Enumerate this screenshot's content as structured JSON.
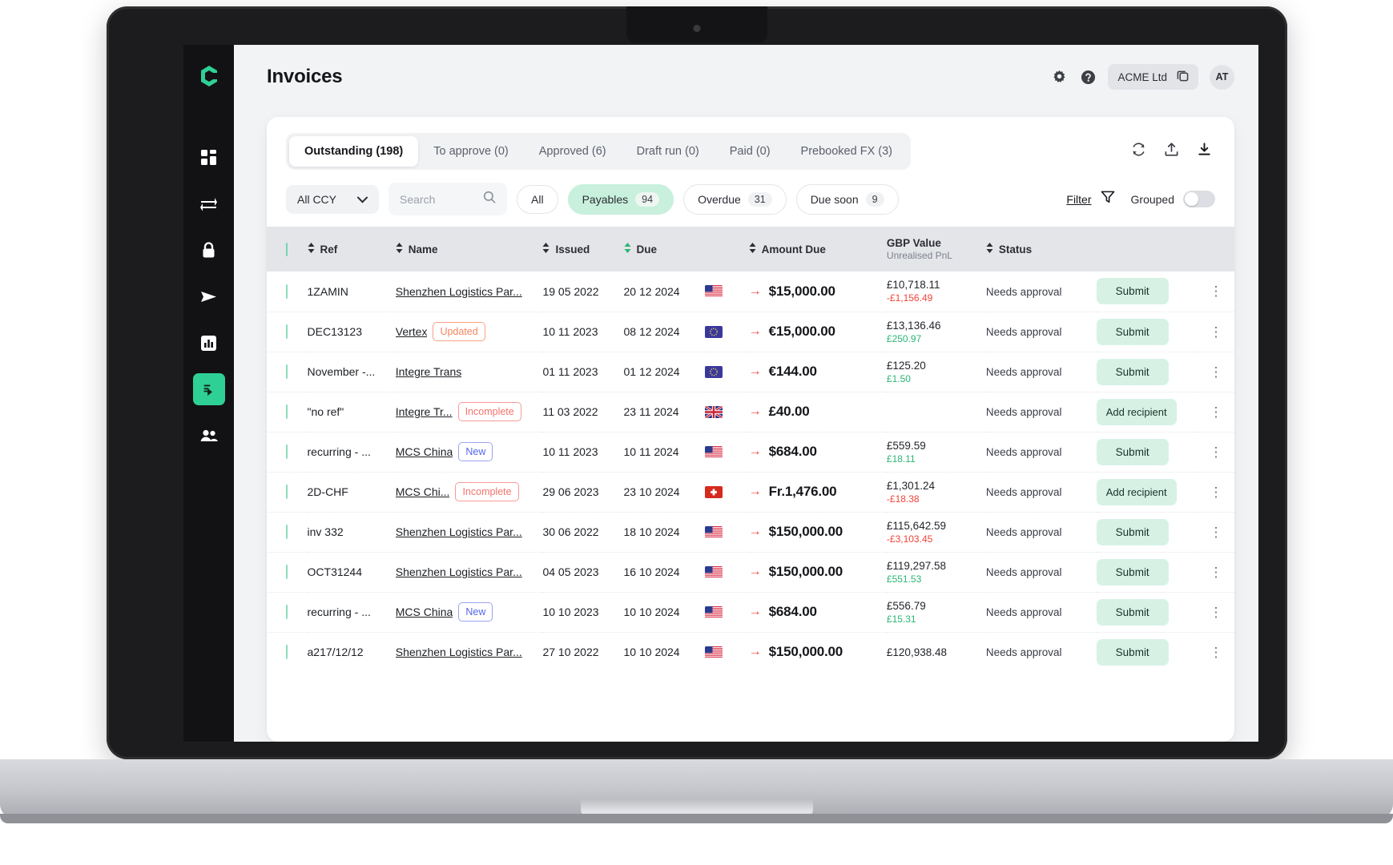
{
  "header": {
    "title": "Invoices",
    "org_name": "ACME Ltd",
    "avatar_initials": "AT"
  },
  "tabs": [
    {
      "label": "Outstanding (198)",
      "active": true
    },
    {
      "label": "To approve (0)",
      "active": false
    },
    {
      "label": "Approved (6)",
      "active": false
    },
    {
      "label": "Draft run (0)",
      "active": false
    },
    {
      "label": "Paid (0)",
      "active": false
    },
    {
      "label": "Prebooked FX (3)",
      "active": false
    }
  ],
  "filters": {
    "currency_select": "All CCY",
    "search_placeholder": "Search",
    "search_value": "",
    "chips": [
      {
        "label": "All",
        "count": "",
        "active": false
      },
      {
        "label": "Payables",
        "count": "94",
        "active": true
      },
      {
        "label": "Overdue",
        "count": "31",
        "active": false
      },
      {
        "label": "Due soon",
        "count": "9",
        "active": false
      }
    ],
    "filter_label": "Filter",
    "grouped_label": "Grouped",
    "grouped_on": false
  },
  "table": {
    "columns": {
      "ref": "Ref",
      "name": "Name",
      "issued": "Issued",
      "due": "Due",
      "amount_due": "Amount Due",
      "gbp_value": "GBP Value",
      "gbp_value_sub": "Unrealised PnL",
      "status": "Status"
    },
    "rows": [
      {
        "ref": "1ZAMIN",
        "name": "Shenzhen Logistics Par...",
        "badge": "",
        "badge_type": "",
        "issued": "19 05 2022",
        "due": "20 12 2024",
        "flag": "us",
        "amount": "$15,000.00",
        "gbp": "£10,718.11",
        "pnl": "-£1,156.49",
        "pnl_sign": "neg",
        "status": "Needs approval",
        "action": "Submit"
      },
      {
        "ref": "DEC13123",
        "name": "Vertex",
        "badge": "Updated",
        "badge_type": "updated",
        "issued": "10 11 2023",
        "due": "08 12 2024",
        "flag": "eu",
        "amount": "€15,000.00",
        "gbp": "£13,136.46",
        "pnl": "£250.97",
        "pnl_sign": "pos",
        "status": "Needs approval",
        "action": "Submit"
      },
      {
        "ref": "November -...",
        "name": "Integre Trans",
        "badge": "",
        "badge_type": "",
        "issued": "01 11 2023",
        "due": "01 12 2024",
        "flag": "eu",
        "amount": "€144.00",
        "gbp": "£125.20",
        "pnl": "£1.50",
        "pnl_sign": "pos",
        "status": "Needs approval",
        "action": "Submit"
      },
      {
        "ref": "\"no ref\"",
        "name": "Integre Tr...",
        "badge": "Incomplete",
        "badge_type": "incomplete",
        "issued": "11 03 2022",
        "due": "23 11 2024",
        "flag": "gb",
        "amount": "£40.00",
        "gbp": "",
        "pnl": "",
        "pnl_sign": "",
        "status": "Needs approval",
        "action": "Add recipient"
      },
      {
        "ref": "recurring - ...",
        "name": "MCS China",
        "badge": "New",
        "badge_type": "new",
        "issued": "10 11 2023",
        "due": "10 11 2024",
        "flag": "us",
        "amount": "$684.00",
        "gbp": "£559.59",
        "pnl": "£18.11",
        "pnl_sign": "pos",
        "status": "Needs approval",
        "action": "Submit"
      },
      {
        "ref": "2D-CHF",
        "name": "MCS Chi...",
        "badge": "Incomplete",
        "badge_type": "incomplete",
        "issued": "29 06 2023",
        "due": "23 10 2024",
        "flag": "ch",
        "amount": "Fr.1,476.00",
        "gbp": "£1,301.24",
        "pnl": "-£18.38",
        "pnl_sign": "neg",
        "status": "Needs approval",
        "action": "Add recipient"
      },
      {
        "ref": "inv 332",
        "name": "Shenzhen Logistics Par...",
        "badge": "",
        "badge_type": "",
        "issued": "30 06 2022",
        "due": "18 10 2024",
        "flag": "us",
        "amount": "$150,000.00",
        "gbp": "£115,642.59",
        "pnl": "-£3,103.45",
        "pnl_sign": "neg",
        "status": "Needs approval",
        "action": "Submit"
      },
      {
        "ref": "OCT31244",
        "name": "Shenzhen Logistics Par...",
        "badge": "",
        "badge_type": "",
        "issued": "04 05 2023",
        "due": "16 10 2024",
        "flag": "us",
        "amount": "$150,000.00",
        "gbp": "£119,297.58",
        "pnl": "£551.53",
        "pnl_sign": "pos",
        "status": "Needs approval",
        "action": "Submit"
      },
      {
        "ref": "recurring - ...",
        "name": "MCS China",
        "badge": "New",
        "badge_type": "new",
        "issued": "10 10 2023",
        "due": "10 10 2024",
        "flag": "us",
        "amount": "$684.00",
        "gbp": "£556.79",
        "pnl": "£15.31",
        "pnl_sign": "pos",
        "status": "Needs approval",
        "action": "Submit"
      },
      {
        "ref": "a217/12/12",
        "name": "Shenzhen Logistics Par...",
        "badge": "",
        "badge_type": "",
        "issued": "27 10 2022",
        "due": "10 10 2024",
        "flag": "us",
        "amount": "$150,000.00",
        "gbp": "£120,938.48",
        "pnl": "",
        "pnl_sign": "",
        "status": "Needs approval",
        "action": "Submit"
      }
    ]
  },
  "colors": {
    "accent_green": "#2fd096",
    "chip_active_bg": "#c8f0dd",
    "badge_updated": "#f5865e",
    "badge_incomplete": "#f4736d",
    "badge_new": "#5566e8",
    "negative": "#f04438",
    "positive": "#2bb673",
    "sidebar_bg": "#121214"
  },
  "icons": {
    "logo": "company-logo",
    "nav": [
      "dashboard-icon",
      "transfers-icon",
      "lock-icon",
      "send-icon",
      "reports-icon",
      "invoices-icon",
      "team-icon"
    ],
    "settings": "gear-icon",
    "help": "help-circle-icon",
    "copy": "copy-icon",
    "refresh": "refresh-icon",
    "upload": "upload-icon",
    "download": "download-icon",
    "search": "search-icon",
    "filter": "filter-icon",
    "chevron": "chevron-down-icon",
    "sort": "sort-icon",
    "kebab": "kebab-menu-icon",
    "arrow_out": "arrow-outgoing-icon"
  }
}
